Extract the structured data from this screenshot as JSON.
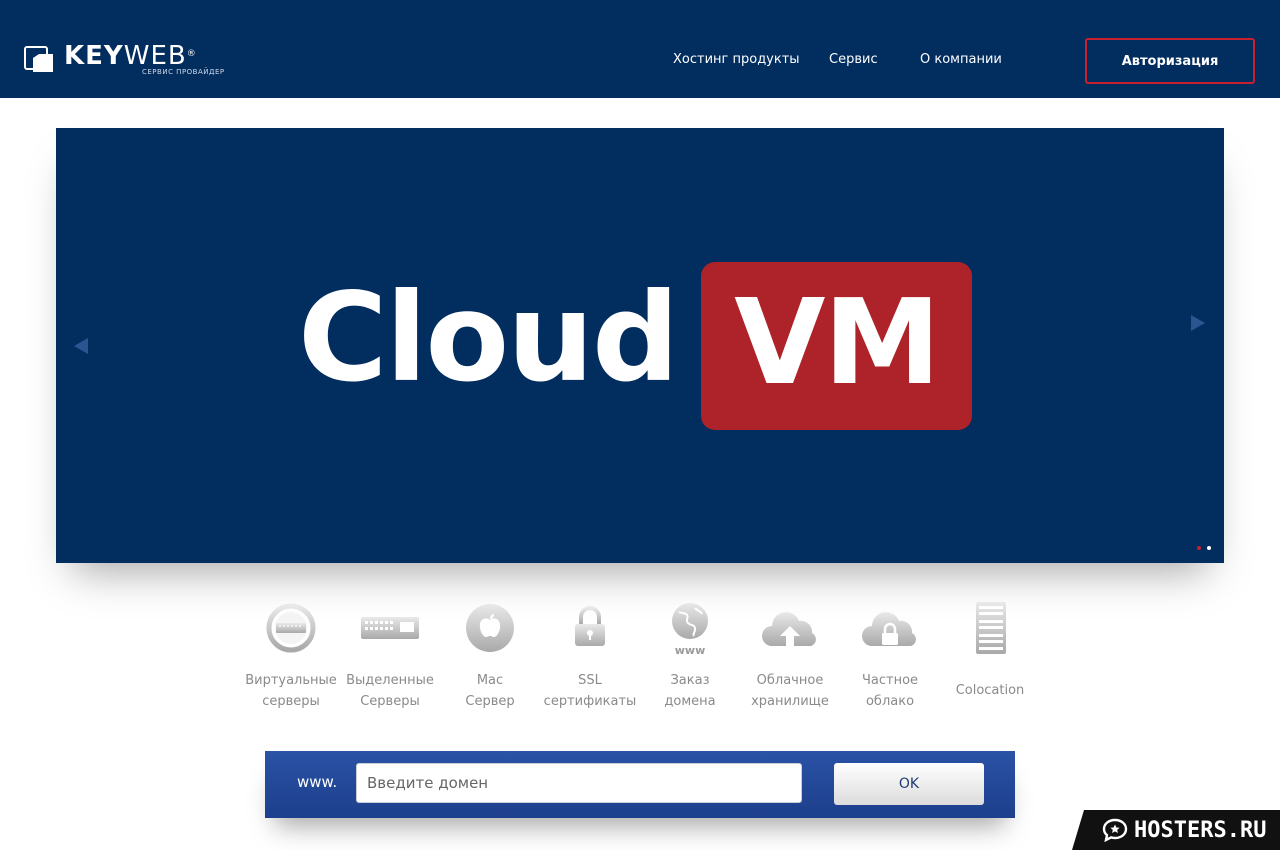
{
  "header": {
    "logo": {
      "word_bold": "KEY",
      "word_light": "WEB",
      "mark": "®",
      "subtitle": "СЕРВИС ПРОВАЙДЕР"
    },
    "nav": [
      {
        "label": "Хостинг продукты"
      },
      {
        "label": "Сервис"
      },
      {
        "label": "О компании"
      }
    ],
    "auth_label": "Авторизация"
  },
  "slider": {
    "headline_main": "Cloud",
    "headline_badge": "VM",
    "badge_color": "#ae2329",
    "background_color": "#022d5f",
    "active_dot": 1,
    "total_dots": 2
  },
  "products": [
    {
      "label": "Виртуальные\nсерверы",
      "icon": "virtual-server-icon"
    },
    {
      "label": "Выделенные\nСерверы",
      "icon": "dedicated-server-icon"
    },
    {
      "label": "Mac\nСервер",
      "icon": "apple-icon"
    },
    {
      "label": "SSL\nсертификаты",
      "icon": "lock-icon"
    },
    {
      "label": "Заказ\nдомена",
      "icon": "globe-www-icon"
    },
    {
      "label": "Облачное\nхранилище",
      "icon": "cloud-upload-icon"
    },
    {
      "label": "Частное\nоблако",
      "icon": "cloud-lock-icon"
    },
    {
      "label": "Colocation",
      "icon": "server-rack-icon"
    }
  ],
  "domain_search": {
    "prefix": "www.",
    "placeholder": "Введите домен",
    "value": "",
    "submit_label": "OK"
  },
  "watermark": {
    "text": "HOSTERS.RU"
  }
}
